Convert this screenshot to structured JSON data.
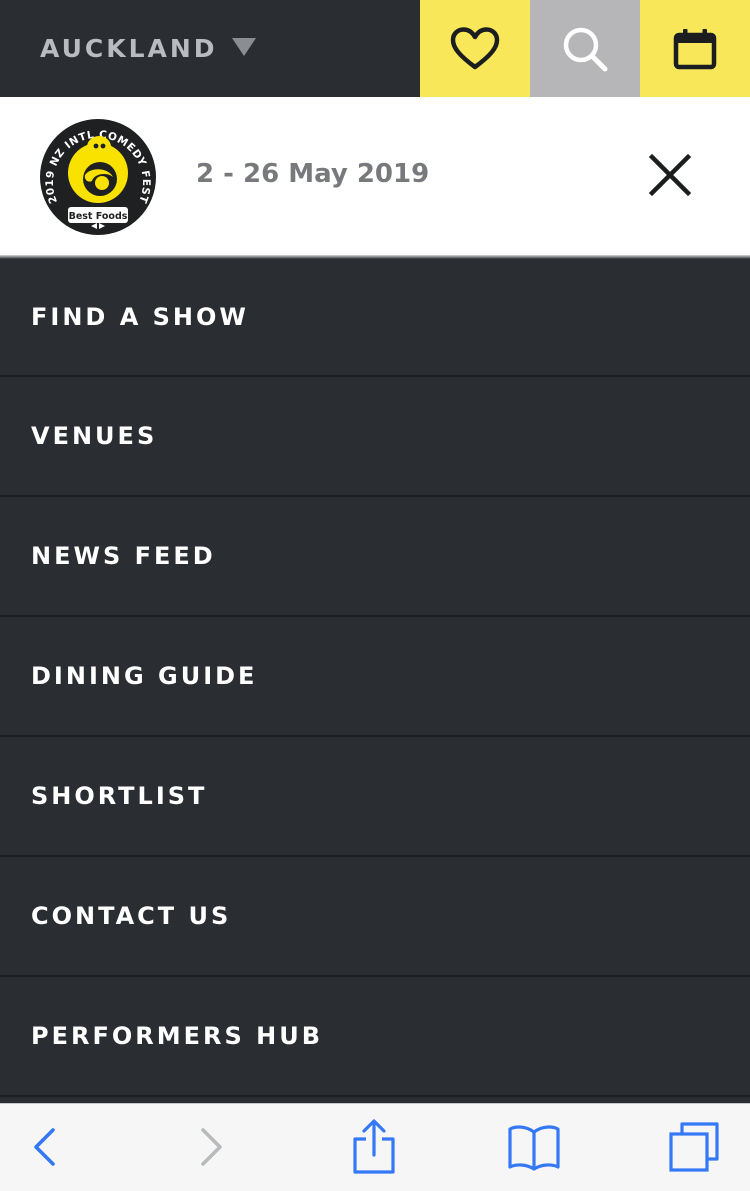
{
  "topbar": {
    "city": "AUCKLAND",
    "caret_icon": "triangle-down-icon",
    "heart_icon": "heart-icon",
    "search_icon": "search-icon",
    "calendar_icon": "calendar-icon"
  },
  "festival": {
    "logo_ring_text": "2019 NZ INTL COMEDY FEST",
    "logo_badge": "Best Foods",
    "dates": "2 - 26 May 2019",
    "close_icon": "close-icon"
  },
  "menu": {
    "items": [
      {
        "label": "FIND A SHOW"
      },
      {
        "label": "VENUES"
      },
      {
        "label": "NEWS FEED"
      },
      {
        "label": "DINING GUIDE"
      },
      {
        "label": "SHORTLIST"
      },
      {
        "label": "CONTACT US"
      },
      {
        "label": "PERFORMERS HUB"
      }
    ]
  },
  "browser_toolbar": {
    "back_icon": "chevron-left-icon",
    "forward_icon": "chevron-right-icon",
    "share_icon": "share-icon",
    "bookmarks_icon": "book-icon",
    "tabs_icon": "tabs-icon"
  },
  "colors": {
    "dark_bg": "#2a2e32",
    "accent_yellow": "#f9e75a",
    "search_gray": "#b6b6b8",
    "ios_blue": "#3478f6"
  }
}
